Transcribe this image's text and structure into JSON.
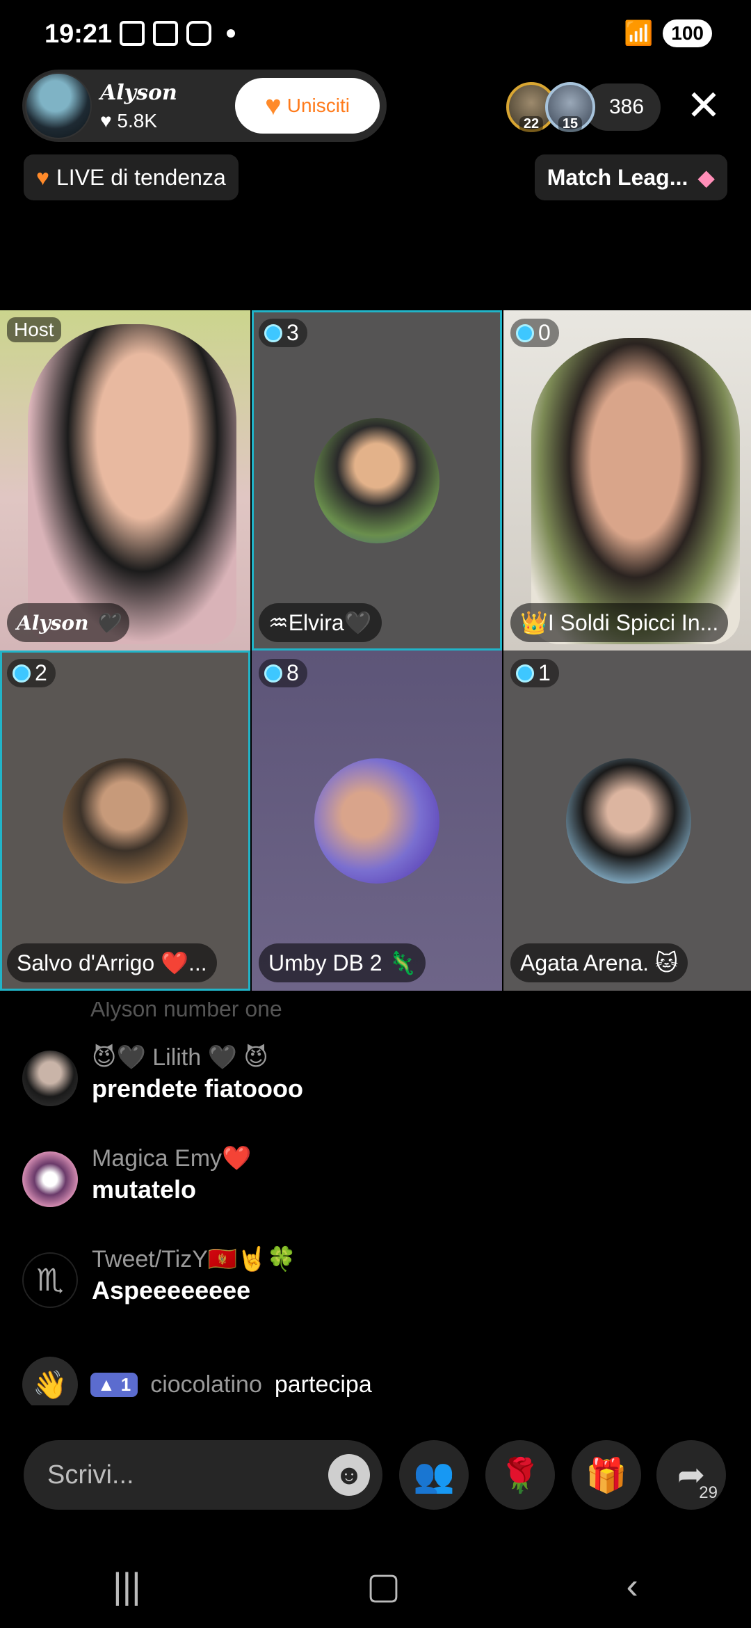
{
  "status_bar": {
    "time": "19:21",
    "battery": "100"
  },
  "host": {
    "name": "Alyson",
    "likes": "5.8K",
    "join_label": "Unisciti"
  },
  "viewers": {
    "avatar1_count": "22",
    "avatar2_count": "15",
    "total": "386"
  },
  "pills": {
    "trending": "LIVE di tendenza",
    "match": "Match Leag..."
  },
  "grid": {
    "host_tag": "Host",
    "tiles": [
      {
        "name": "Alyson",
        "badge": ""
      },
      {
        "name": "♒Elvira🖤",
        "badge": "3"
      },
      {
        "name": "👑I Soldi Spicci In...",
        "badge": "0"
      },
      {
        "name": "Salvo d'Arrigo ❤️...",
        "badge": "2"
      },
      {
        "name": "Umby DB 2 🦎",
        "badge": "8"
      },
      {
        "name": "Agata Arena. 🐱",
        "badge": "1"
      }
    ]
  },
  "chat": {
    "ghost": "Alyson number one",
    "messages": [
      {
        "user": "😈🖤 Lilith 🖤 😈",
        "text": "prendete fiatoooo"
      },
      {
        "user": "Magica Emy❤️",
        "text": "mutatelo"
      },
      {
        "user": "Tweet/TizY🇲🇪🤘🍀",
        "text": "Aspeeeeeeee"
      }
    ],
    "join": {
      "level": "1",
      "user": "ciocolatino",
      "action": "partecipa"
    }
  },
  "bottom": {
    "placeholder": "Scrivi...",
    "share_count": "29"
  },
  "colors": {
    "accent": "#21b4c8",
    "join": "#ff7a1a"
  }
}
